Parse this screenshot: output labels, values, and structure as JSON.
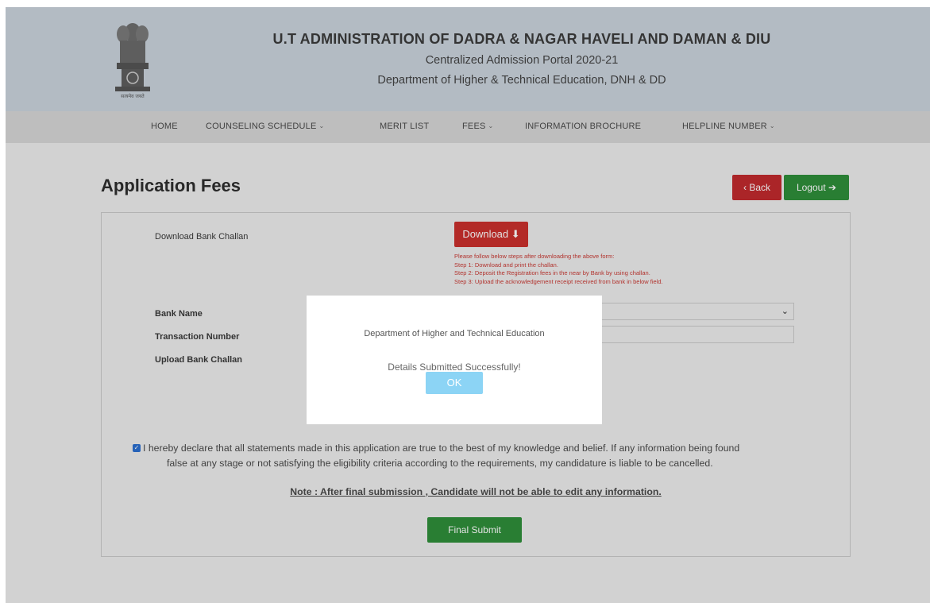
{
  "header": {
    "emblem_caption": "सत्यमेव जयते",
    "title": "U.T ADMINISTRATION OF DADRA & NAGAR HAVELI AND DAMAN & DIU",
    "subtitle_1": "Centralized Admission Portal 2020-21",
    "subtitle_2": "Department of Higher & Technical Education, DNH & DD"
  },
  "nav": {
    "items": [
      {
        "label": "HOME",
        "dropdown": false
      },
      {
        "label": "COUNSELING SCHEDULE",
        "dropdown": true
      },
      {
        "label": "MERIT LIST",
        "dropdown": false
      },
      {
        "label": "FEES",
        "dropdown": true
      },
      {
        "label": "INFORMATION BROCHURE",
        "dropdown": false
      },
      {
        "label": "HELPLINE NUMBER",
        "dropdown": true
      }
    ],
    "caret": "⌄"
  },
  "page": {
    "title": "Application Fees",
    "back_label": "‹ Back",
    "logout_label": "Logout ➔"
  },
  "form": {
    "download_challan_label": "Download Bank Challan",
    "download_button": "Download ⬇",
    "instructions": [
      "Please follow below steps after downloading the above form:",
      "Step 1: Download and print the challan.",
      "Step 2: Deposit the Registration fees in the near by Bank by using challan.",
      "Step 3: Upload the acknowledgement receipt received from bank in below field."
    ],
    "bank_name_label": "Bank Name",
    "bank_name_value": "",
    "transaction_number_label": "Transaction Number",
    "transaction_number_value": "",
    "upload_challan_label": "Upload Bank Challan",
    "declaration_checked": true,
    "declaration_line1": "I hereby declare that all statements made in this application are true to the best of my knowledge and belief. If any information being found",
    "declaration_line2": "false at any stage or not satisfying the eligibility criteria according to the requirements, my candidature is liable to be cancelled.",
    "note": "Note : After final submission , Candidate will not be able to edit any information.",
    "final_submit": "Final Submit"
  },
  "modal": {
    "title": "Department of Higher and Technical Education",
    "message": "Details Submitted Successfully!",
    "ok_label": "OK"
  },
  "colors": {
    "header_bg": "#c9d2dc",
    "nav_bg": "#d6d6d6",
    "danger": "#c9302c",
    "success": "#2f8e3a",
    "ok_button": "#8cd4f5"
  }
}
